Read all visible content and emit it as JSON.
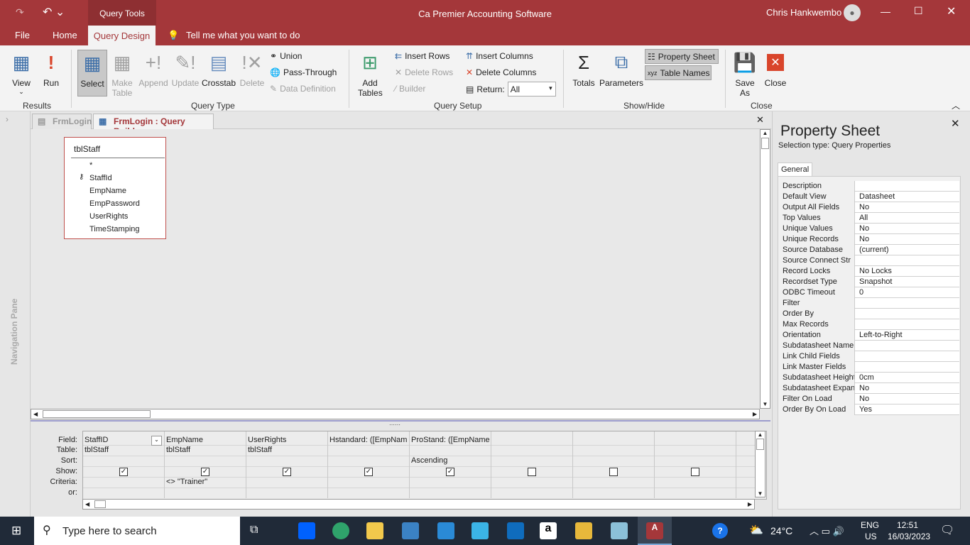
{
  "titlebar": {
    "app_title": "Ca Premier Accounting Software",
    "context_tab": "Query Tools",
    "user": "Chris Hankwembo"
  },
  "ribbon_tabs": [
    "File",
    "Home",
    "Query Design"
  ],
  "tell_me": "Tell me what you want to do",
  "ribbon": {
    "results": {
      "group": "Results",
      "view": "View",
      "run": "Run"
    },
    "query_type": {
      "group": "Query Type",
      "select": "Select",
      "make_table": "Make Table",
      "append": "Append",
      "update": "Update",
      "crosstab": "Crosstab",
      "delete": "Delete",
      "union": "Union",
      "pass_through": "Pass-Through",
      "data_definition": "Data Definition"
    },
    "query_setup": {
      "group": "Query Setup",
      "add_tables": "Add Tables",
      "insert_rows": "Insert Rows",
      "delete_rows": "Delete Rows",
      "builder": "Builder",
      "insert_columns": "Insert Columns",
      "delete_columns": "Delete Columns",
      "return_label": "Return:",
      "return_value": "All"
    },
    "show_hide": {
      "group": "Show/Hide",
      "totals": "Totals",
      "parameters": "Parameters",
      "property_sheet": "Property Sheet",
      "table_names": "Table Names"
    },
    "close": {
      "group": "Close",
      "save_as": "Save As",
      "close": "Close"
    }
  },
  "doc_tabs": [
    "FrmLogin",
    "FrmLogin : Query Builder"
  ],
  "nav_pane": "Navigation Pane",
  "table": {
    "name": "tblStaff",
    "fields": [
      "*",
      "StaffId",
      "EmpName",
      "EmpPassword",
      "UserRights",
      "TimeStamping"
    ]
  },
  "grid": {
    "row_labels": [
      "Field:",
      "Table:",
      "Sort:",
      "Show:",
      "Criteria:",
      "or:"
    ],
    "columns": [
      {
        "field": "StaffID",
        "table": "tblStaff",
        "sort": "",
        "show": true,
        "criteria": ""
      },
      {
        "field": "EmpName",
        "table": "tblStaff",
        "sort": "",
        "show": true,
        "criteria": "<> \"Trainer\""
      },
      {
        "field": "UserRights",
        "table": "tblStaff",
        "sort": "",
        "show": true,
        "criteria": ""
      },
      {
        "field": "Hstandard: ([EmpNam",
        "table": "",
        "sort": "",
        "show": true,
        "criteria": ""
      },
      {
        "field": "ProStand: ([EmpName",
        "table": "",
        "sort": "Ascending",
        "show": true,
        "criteria": ""
      },
      {
        "field": "",
        "table": "",
        "sort": "",
        "show": false,
        "criteria": ""
      },
      {
        "field": "",
        "table": "",
        "sort": "",
        "show": false,
        "criteria": ""
      },
      {
        "field": "",
        "table": "",
        "sort": "",
        "show": false,
        "criteria": ""
      }
    ]
  },
  "property_sheet": {
    "title": "Property Sheet",
    "selection_type": "Selection type:  Query Properties",
    "tab": "General",
    "rows": [
      [
        "Description",
        ""
      ],
      [
        "Default View",
        "Datasheet"
      ],
      [
        "Output All Fields",
        "No"
      ],
      [
        "Top Values",
        "All"
      ],
      [
        "Unique Values",
        "No"
      ],
      [
        "Unique Records",
        "No"
      ],
      [
        "Source Database",
        "(current)"
      ],
      [
        "Source Connect Str",
        ""
      ],
      [
        "Record Locks",
        "No Locks"
      ],
      [
        "Recordset Type",
        "Snapshot"
      ],
      [
        "ODBC Timeout",
        "0"
      ],
      [
        "Filter",
        ""
      ],
      [
        "Order By",
        ""
      ],
      [
        "Max Records",
        ""
      ],
      [
        "Orientation",
        "Left-to-Right"
      ],
      [
        "Subdatasheet Name",
        ""
      ],
      [
        "Link Child Fields",
        ""
      ],
      [
        "Link Master Fields",
        ""
      ],
      [
        "Subdatasheet Height",
        "0cm"
      ],
      [
        "Subdatasheet Expanded",
        "No"
      ],
      [
        "Filter On Load",
        "No"
      ],
      [
        "Order By On Load",
        "Yes"
      ]
    ]
  },
  "taskbar": {
    "search": "Type here to search",
    "weather": "24°C",
    "lang": "ENG",
    "region": "US",
    "time": "12:51",
    "date": "16/03/2023"
  }
}
